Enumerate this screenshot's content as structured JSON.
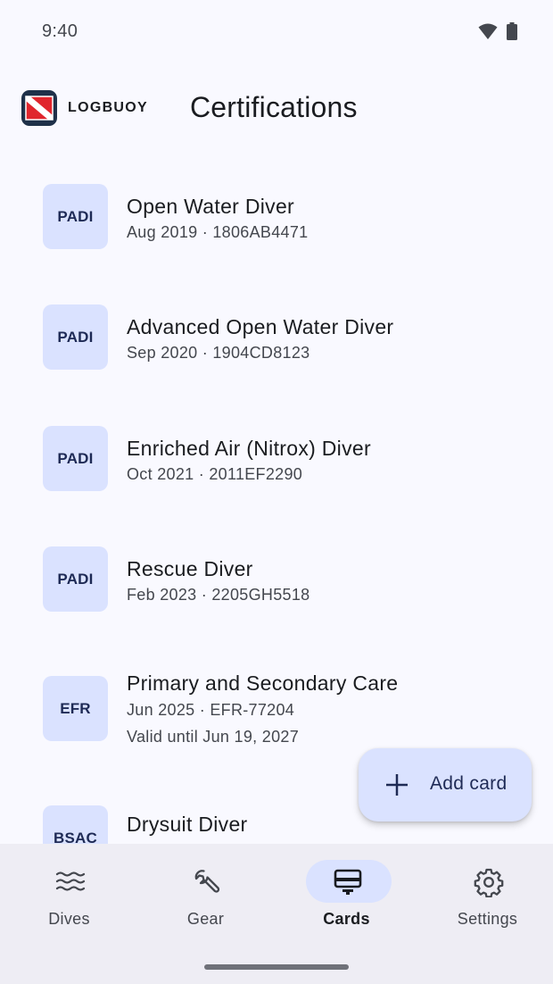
{
  "status_bar": {
    "time": "9:40"
  },
  "app_bar": {
    "brand": "LOGBUOY",
    "title": "Certifications"
  },
  "certifications": [
    {
      "agency": "PADI",
      "name": "Open Water Diver",
      "meta": "Aug 2019 · 1806AB4471"
    },
    {
      "agency": "PADI",
      "name": "Advanced Open Water Diver",
      "meta": "Sep 2020 · 1904CD8123"
    },
    {
      "agency": "PADI",
      "name": "Enriched Air (Nitrox) Diver",
      "meta": "Oct 2021 · 2011EF2290"
    },
    {
      "agency": "PADI",
      "name": "Rescue Diver",
      "meta": "Feb 2023 · 2205GH5518"
    },
    {
      "agency": "EFR",
      "name": "Primary and Secondary Care",
      "meta": "Jun 2025 · EFR-77204",
      "validity": "Valid until Jun 19, 2027"
    },
    {
      "agency": "BSAC",
      "name": "Drysuit Diver",
      "meta": ""
    }
  ],
  "fab": {
    "label": "Add card",
    "icon": "plus-icon"
  },
  "nav": {
    "items": [
      {
        "label": "Dives",
        "icon": "waves-icon"
      },
      {
        "label": "Gear",
        "icon": "wrench-icon"
      },
      {
        "label": "Cards",
        "icon": "card-icon",
        "active": true
      },
      {
        "label": "Settings",
        "icon": "gear-icon"
      }
    ]
  },
  "colors": {
    "accent_container": "#dae2ff",
    "on_accent": "#1e2a55",
    "background": "#f9f9ff",
    "nav_background": "#eeedf4",
    "logo_navy": "#1f3149",
    "dive_flag_red": "#e0262d"
  }
}
